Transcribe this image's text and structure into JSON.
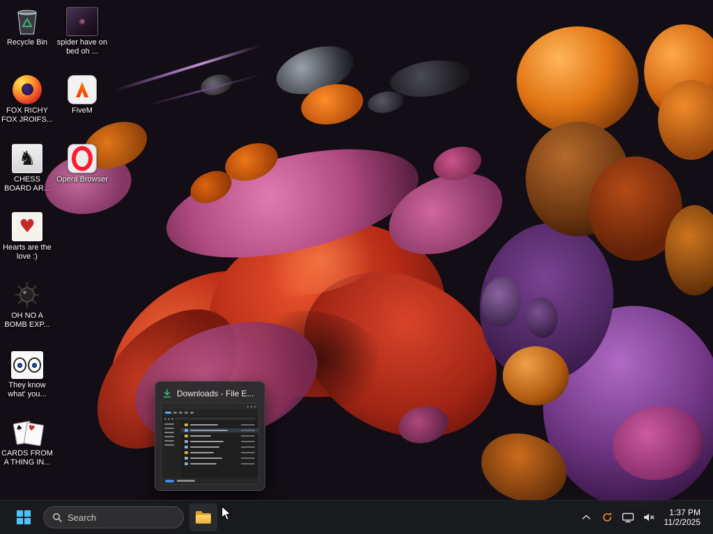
{
  "desktop": {
    "icons": [
      {
        "label": "Recycle Bin",
        "icon": "recycle-bin-icon"
      },
      {
        "label": "spider have on bed oh ...",
        "icon": "photo-thumbnail"
      },
      {
        "label": "FOX RICHY FOX JROIFS...",
        "icon": "firefox-icon"
      },
      {
        "label": "FiveM",
        "icon": "fivem-icon"
      },
      {
        "label": "CHESS BOARD AR...",
        "icon": "chess-thumbnail"
      },
      {
        "label": "Opera Browser",
        "icon": "opera-icon"
      },
      {
        "label": "Hearts are the love :)",
        "icon": "hearts-thumbnail"
      },
      {
        "label": "OH NO A BOMB EXP...",
        "icon": "bomb-thumbnail"
      },
      {
        "label": "They know what' you...",
        "icon": "eyes-thumbnail"
      },
      {
        "label": "CARDS FROM A THING IN...",
        "icon": "cards-thumbnail"
      }
    ]
  },
  "preview_flyout": {
    "title": "Downloads - File E...",
    "icon": "download-icon"
  },
  "taskbar": {
    "start_icon": "windows-start-icon",
    "search_label": "Search",
    "explorer_icon": "file-explorer-icon",
    "tray_icons": [
      "hidden-icons-chevron",
      "sync-icon",
      "network-icon",
      "volume-muted-icon"
    ],
    "clock": {
      "time": "1:37 PM",
      "date": "11/2/2025"
    }
  }
}
